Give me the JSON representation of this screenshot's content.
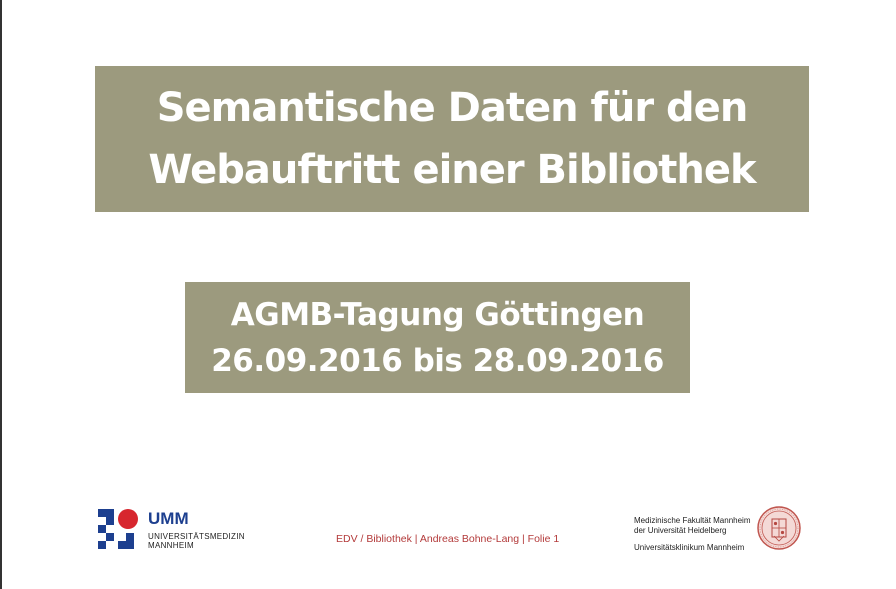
{
  "slide": {
    "title_lines": [
      "Semantische Daten für den",
      "Webauftritt einer Bibliothek"
    ],
    "subtitle_lines": [
      "AGMB-Tagung Göttingen",
      "26.09.2016 bis 28.09.2016"
    ],
    "footer": "EDV / Bibliothek | Andreas Bohne-Lang | Folie 1"
  },
  "umm_logo": {
    "name": "UMM",
    "sub_lines": [
      "UNIVERSITÄTSMEDIZIN",
      "MANNHEIM"
    ],
    "colors": {
      "blue": "#1d3f8f",
      "red": "#d7262e"
    }
  },
  "heidelberg": {
    "lines": [
      "Medizinische Fakultät Mannheim",
      "der Universität Heidelberg"
    ],
    "clinic": "Universitätsklinikum Mannheim",
    "seal_icon": "university-seal-icon"
  },
  "colors": {
    "box": "#9c9a7e",
    "footer_text": "#b33a3a"
  }
}
